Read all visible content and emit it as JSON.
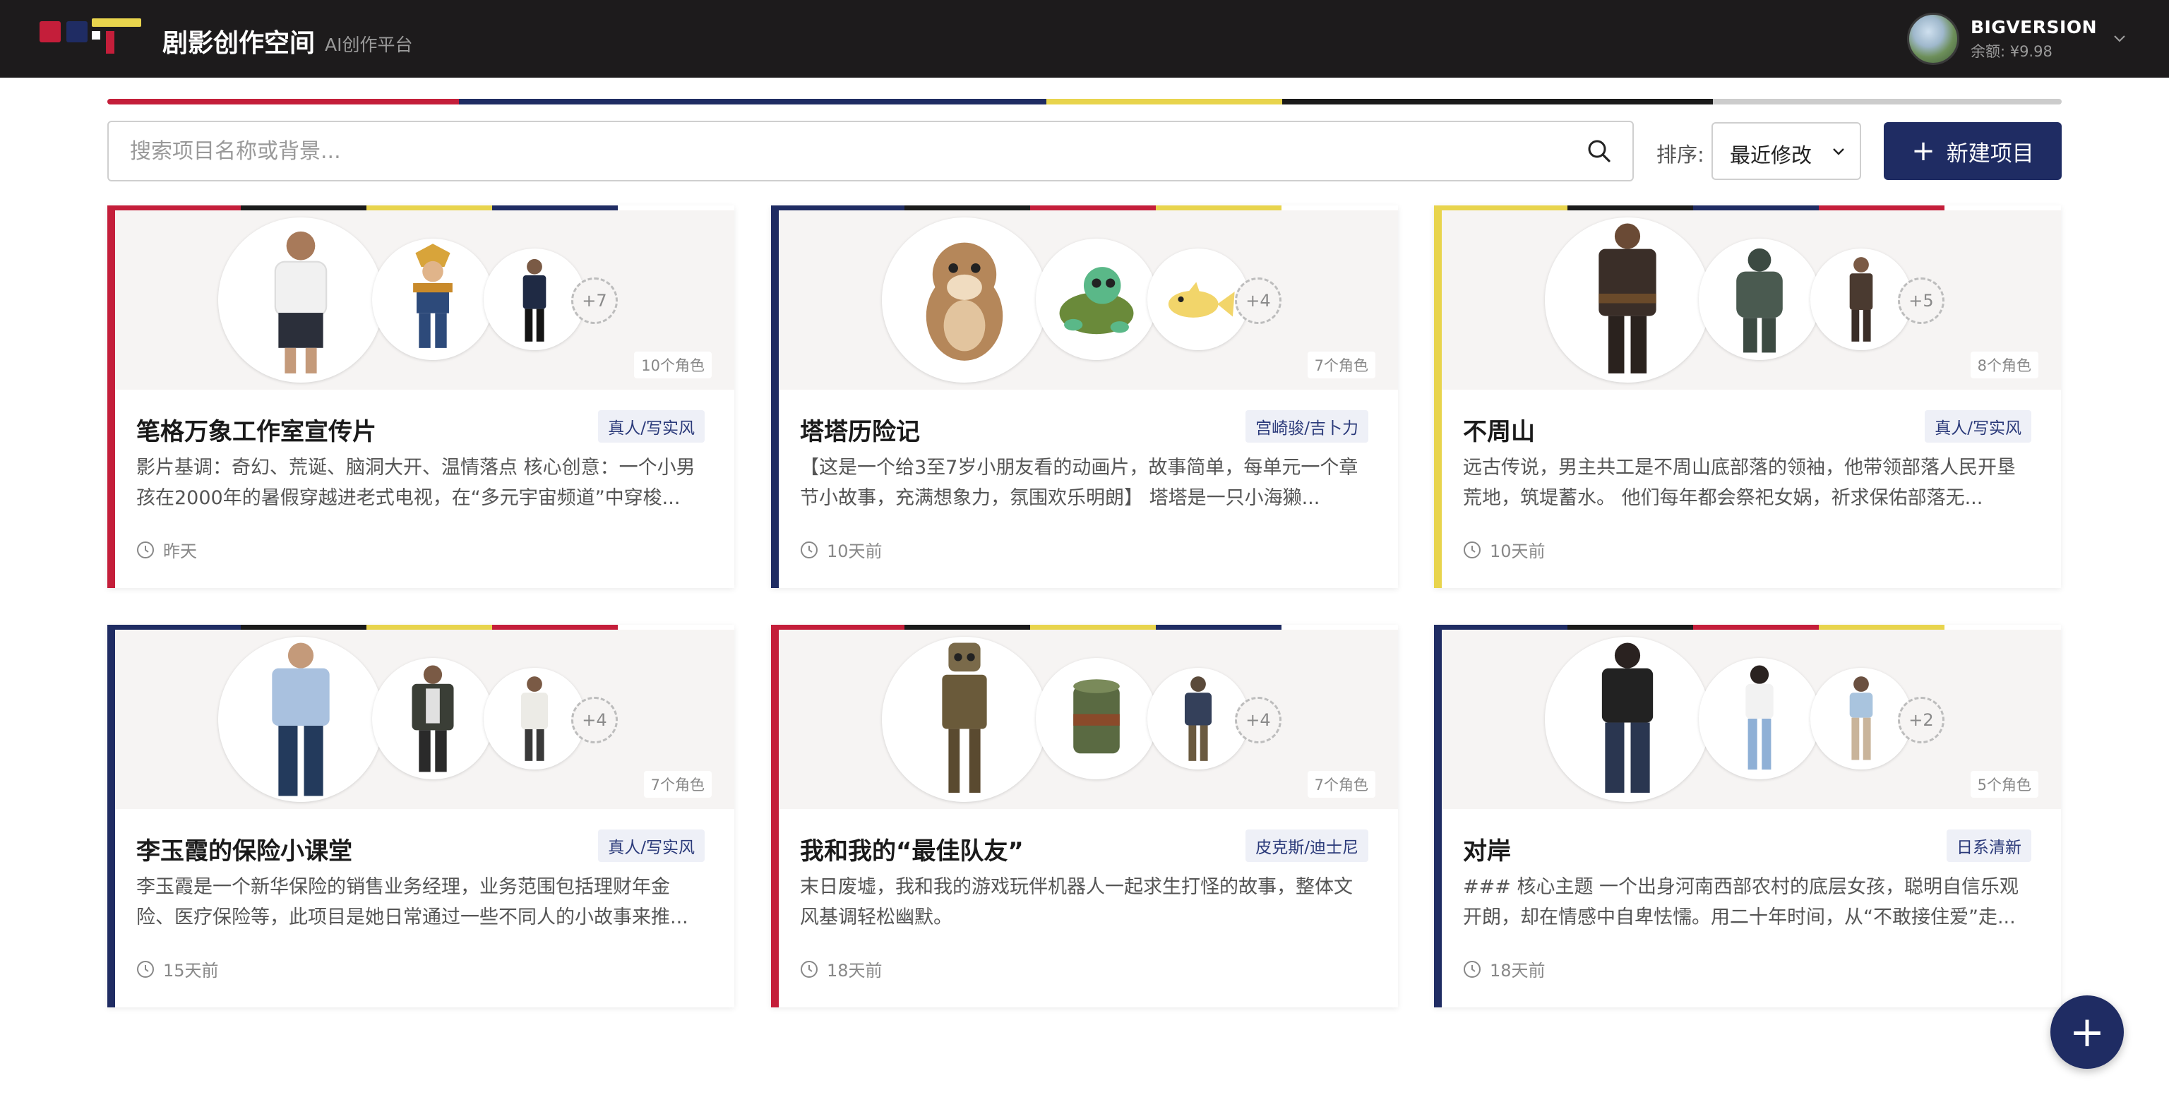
{
  "header": {
    "title": "剧影创作空间",
    "subtitle": "AI创作平台",
    "user": {
      "name": "BIGVERSION",
      "balance": "余额: ¥9.98"
    }
  },
  "toolbar": {
    "search_placeholder": "搜索项目名称或背景...",
    "sort_label": "排序:",
    "sort_value": "最近修改",
    "new_project_label": "新建项目"
  },
  "colors": {
    "red": "#c41e3a",
    "navy": "#1f2c63",
    "yellow": "#e8d44d",
    "black": "#1a1a1a",
    "grey": "#cccccc"
  },
  "projects": [
    {
      "title": "笔格万象工作室宣传片",
      "style": "真人/写实风",
      "description": "影片基调：奇幻、荒诞、脑洞大开、温情落点 核心创意：一个小男孩在2000年的暑假穿越进老式电视，在“多元宇宙频道”中穿梭...",
      "time": "昨天",
      "more": "+7",
      "role_count": "10个角色"
    },
    {
      "title": "塔塔历险记",
      "style": "宫崎骏/吉卜力",
      "description": "【这是一个给3至7岁小朋友看的动画片，故事简单，每单元一个章节小故事，充满想象力，氛围欢乐明朗】 塔塔是一只小海獭...",
      "time": "10天前",
      "more": "+4",
      "role_count": "7个角色"
    },
    {
      "title": "不周山",
      "style": "真人/写实风",
      "description": "远古传说，男主共工是不周山底部落的领袖，他带领部落人民开垦荒地，筑堤蓄水。 他们每年都会祭祀女娲，祈求保佑部落无...",
      "time": "10天前",
      "more": "+5",
      "role_count": "8个角色"
    },
    {
      "title": "李玉霞的保险小课堂",
      "style": "真人/写实风",
      "description": "李玉霞是一个新华保险的销售业务经理，业务范围包括理财年金险、医疗保险等，此项目是她日常通过一些不同人的小故事来推...",
      "time": "15天前",
      "more": "+4",
      "role_count": "7个角色"
    },
    {
      "title": "我和我的“最佳队友”",
      "style": "皮克斯/迪士尼",
      "description": "末日废墟，我和我的游戏玩伴机器人一起求生打怪的故事，整体文风基调轻松幽默。",
      "time": "18天前",
      "more": "+4",
      "role_count": "7个角色"
    },
    {
      "title": "对岸",
      "style": "日系清新",
      "description": "### 核心主题 一个出身河南西部农村的底层女孩，聪明自信乐观开朗，却在情感中自卑怯懦。用二十年时间，从“不敢接住爱”走...",
      "time": "18天前",
      "more": "+2",
      "role_count": "5个角色"
    }
  ],
  "fab_label": "+"
}
